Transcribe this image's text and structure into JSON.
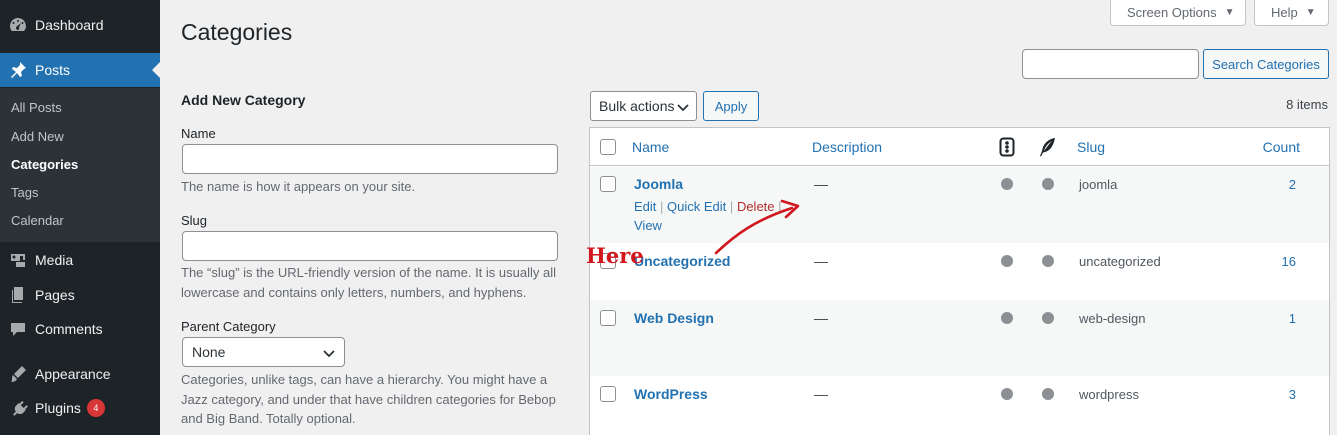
{
  "sidebar": {
    "top": [
      {
        "label": "Dashboard",
        "icon": "dashboard-icon"
      },
      {
        "label": "Posts",
        "icon": "pin-icon"
      },
      {
        "label": "Media",
        "icon": "media-icon"
      },
      {
        "label": "Pages",
        "icon": "pages-icon"
      },
      {
        "label": "Comments",
        "icon": "comments-icon"
      },
      {
        "label": "Appearance",
        "icon": "appearance-icon"
      },
      {
        "label": "Plugins",
        "icon": "plugins-icon"
      }
    ],
    "plugins_badge": "4",
    "submenu": [
      {
        "label": "All Posts"
      },
      {
        "label": "Add New"
      },
      {
        "label": "Categories"
      },
      {
        "label": "Tags"
      },
      {
        "label": "Calendar"
      }
    ]
  },
  "header": {
    "title": "Categories",
    "screen_options": "Screen Options",
    "help": "Help"
  },
  "search": {
    "value": "",
    "button": "Search Categories"
  },
  "form": {
    "title": "Add New Category",
    "name_label": "Name",
    "name_value": "",
    "name_help": "The name is how it appears on your site.",
    "slug_label": "Slug",
    "slug_value": "",
    "slug_help_line1": "The “slug” is the URL-friendly version of the name. It is usually all",
    "slug_help_line2": "lowercase and contains only letters, numbers, and hyphens.",
    "parent_label": "Parent Category",
    "parent_value": "None",
    "parent_help_line1": "Categories, unlike tags, can have a hierarchy. You might have a",
    "parent_help_line2": "Jazz category, and under that have children categories for Bebop",
    "parent_help_line3": "and Big Band. Totally optional."
  },
  "table": {
    "bulk_actions": "Bulk actions",
    "apply": "Apply",
    "items_count": "8 items",
    "columns": {
      "name": "Name",
      "description": "Description",
      "slug": "Slug",
      "count": "Count"
    },
    "row_actions": {
      "edit": "Edit",
      "quick_edit": "Quick Edit",
      "delete": "Delete",
      "view": "View",
      "sep": "|"
    },
    "rows": [
      {
        "name": "Joomla",
        "description": "—",
        "slug": "joomla",
        "count": "2"
      },
      {
        "name": "Uncategorized",
        "description": "—",
        "slug": "uncategorized",
        "count": "16"
      },
      {
        "name": "Web Design",
        "description": "—",
        "slug": "web-design",
        "count": "1"
      },
      {
        "name": "WordPress",
        "description": "—",
        "slug": "wordpress",
        "count": "3"
      }
    ]
  },
  "annotation": {
    "text": "Here",
    "color": "#d1161d"
  },
  "colors": {
    "sidebar_bg": "#1d2327",
    "accent": "#2271b1",
    "delete": "#b32d2e"
  }
}
